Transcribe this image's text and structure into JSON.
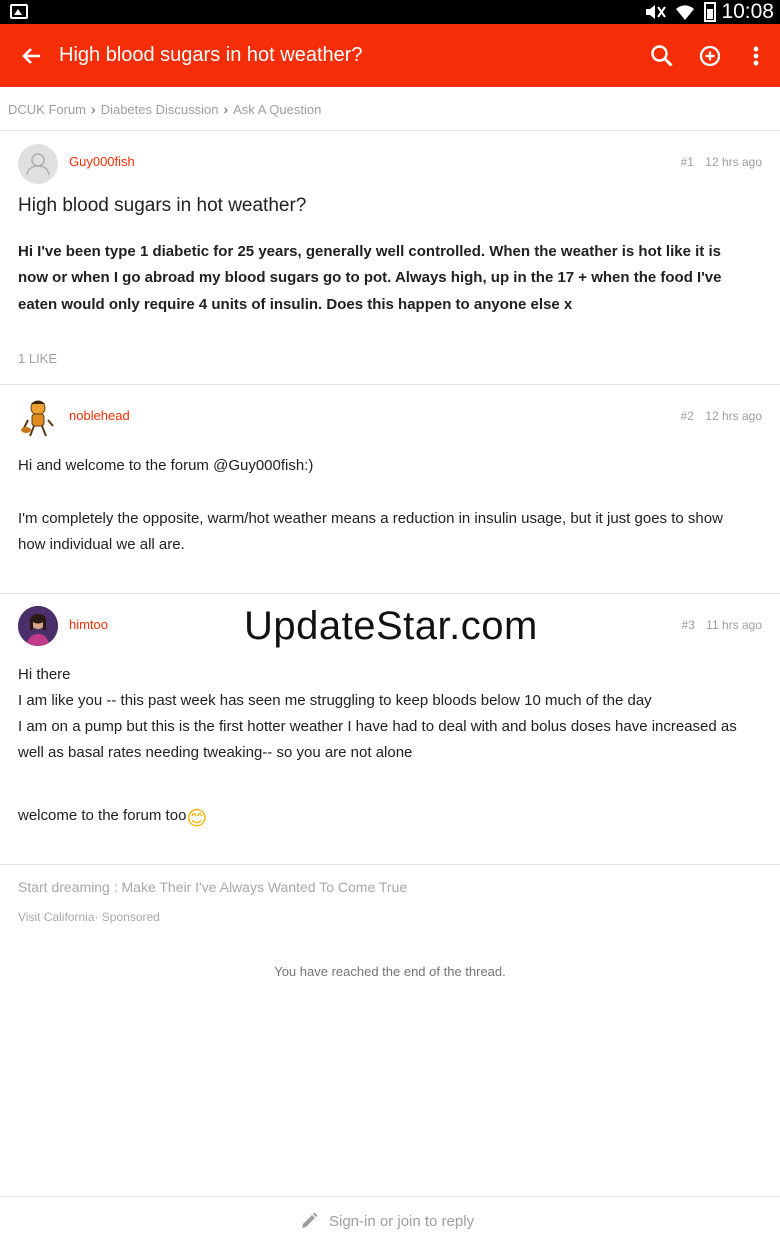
{
  "status_bar": {
    "time": "10:08"
  },
  "app_bar": {
    "title": "High blood sugars in hot weather?"
  },
  "breadcrumb": [
    "DCUK Forum",
    "Diabetes Discussion",
    "Ask A Question"
  ],
  "posts": [
    {
      "author": "Guy000fish",
      "number": "#1",
      "time": "12 hrs ago",
      "title": "High blood sugars in hot weather?",
      "body": "Hi I've been type 1 diabetic for 25 years, generally well controlled. When the weather is hot like it is now or when I go abroad my blood sugars go to pot. Always high, up in the 17 + when the food I've eaten would only require 4 units of insulin. Does this happen to anyone else x",
      "likes": "1 LIKE"
    },
    {
      "author": "noblehead",
      "number": "#2",
      "time": "12 hrs ago",
      "paragraphs": [
        "Hi and welcome to the forum @Guy000fish:)",
        "I'm completely the opposite, warm/hot weather means a reduction in insulin usage, but it just goes to show how individual we all are."
      ]
    },
    {
      "author": "himtoo",
      "number": "#3",
      "time": "11 hrs ago",
      "lines": [
        "Hi there",
        "I am like you -- this past week has seen me struggling to keep bloods below 10 much of the day",
        "I am on a pump but this is the first hotter weather I have had to deal with and bolus doses have increased as well as basal rates needing tweaking-- so you are not alone"
      ],
      "closing": "welcome to the forum too",
      "emoji": "😊"
    }
  ],
  "watermark": "UpdateStar.com",
  "sponsored": {
    "title": "Start dreaming : Make Their I've Always Wanted To Come True",
    "by": "Visit California· Sponsored"
  },
  "end_note": "You have reached the end of the thread.",
  "reply_bar": {
    "label": "Sign-in or join to reply"
  },
  "colors": {
    "accent": "#f52e07",
    "muted": "#9e9e9e"
  }
}
